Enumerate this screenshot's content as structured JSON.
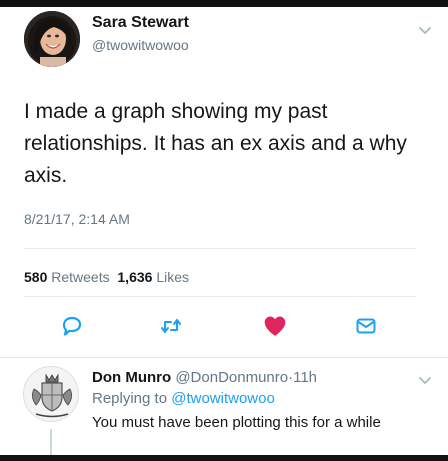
{
  "tweet": {
    "author_name": "Sara Stewart",
    "author_handle": "@twowitwowoo",
    "text": "I made a graph showing my past relationships. It has an ex axis and a why axis.",
    "timestamp": "8/21/17, 2:14 AM",
    "stats": {
      "retweets_count": "580",
      "retweets_label": "Retweets",
      "likes_count": "1,636",
      "likes_label": "Likes"
    },
    "actions": [
      "reply-icon",
      "retweet-icon",
      "heart-icon",
      "envelope-icon"
    ],
    "like_color": "#e0245e",
    "icon_color": "#1da1f2"
  },
  "reply": {
    "author_name": "Don Munro",
    "author_handle": "@DonDonmunro",
    "separator": "·",
    "age": "11h",
    "replying_prefix": "Replying to",
    "replying_handle": "@twowitwowoo",
    "text": "You must have been plotting this for a while"
  },
  "colors": {
    "text_primary": "#14171a",
    "text_secondary": "#657786",
    "link": "#1da1f2",
    "divider": "#e6ecf0"
  }
}
